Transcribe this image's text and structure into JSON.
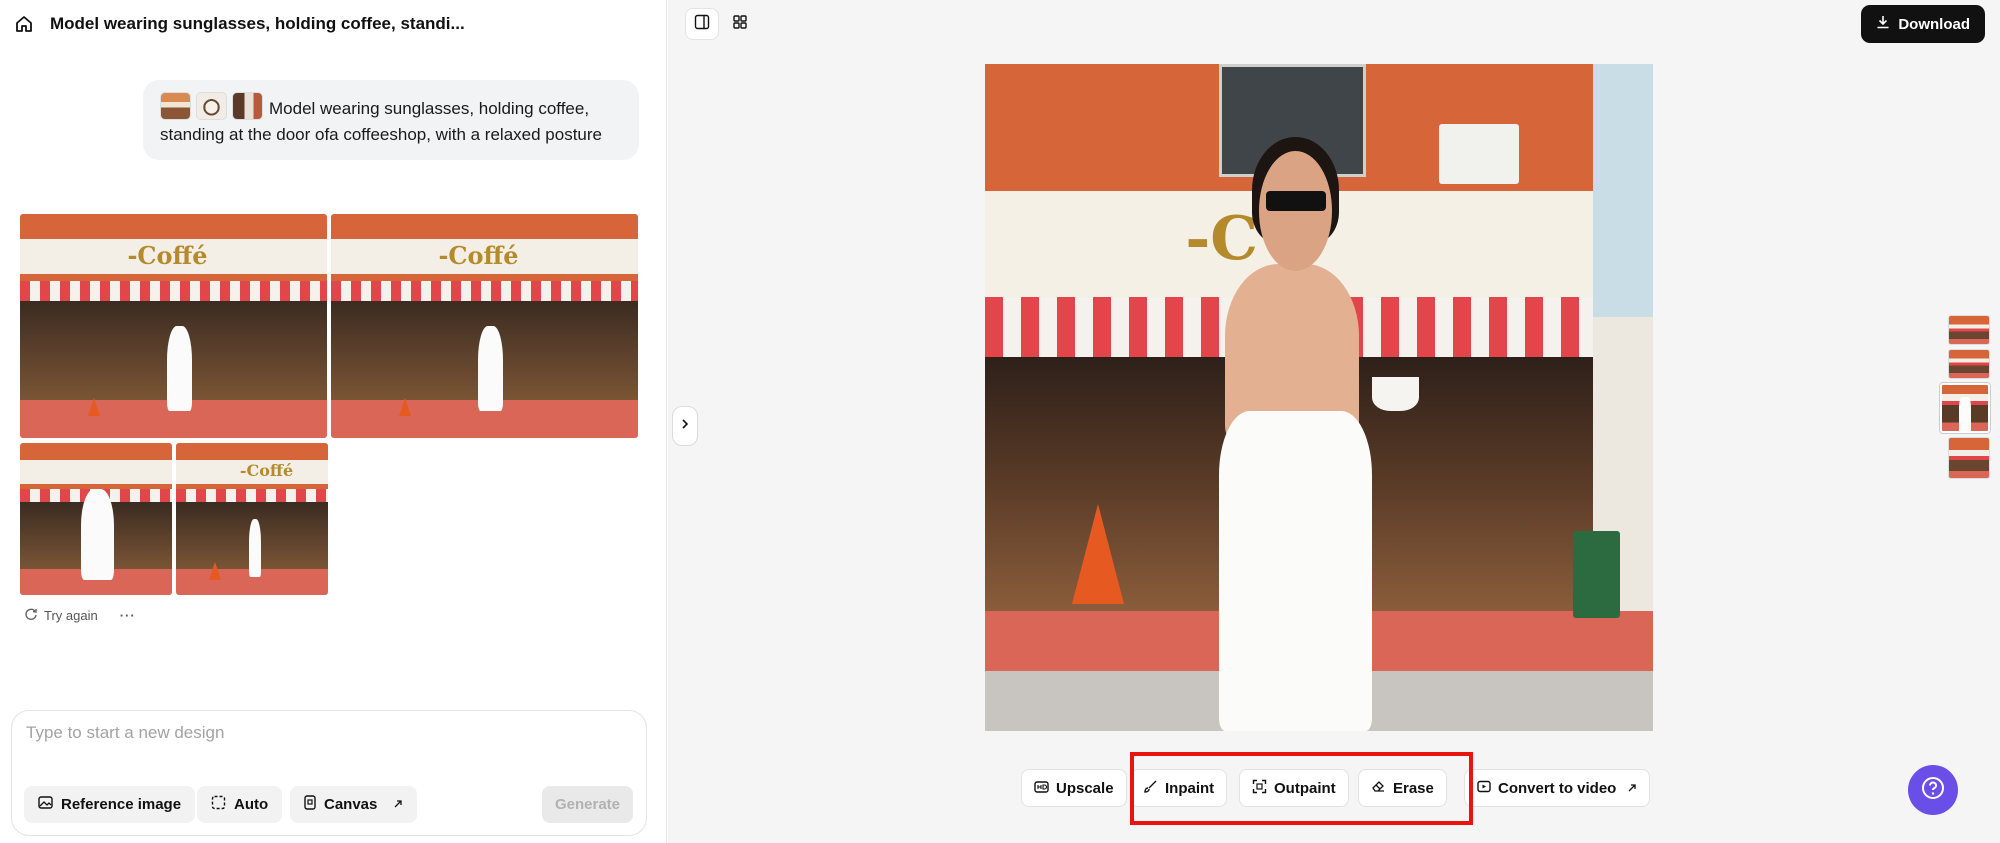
{
  "header": {
    "title": "Model wearing sunglasses, holding coffee, standi..."
  },
  "prompt": {
    "text": "Model wearing sunglasses, holding coffee, standing at the door ofa coffeeshop, with a relaxed posture"
  },
  "gallery": {
    "sign_text": "-Coffé"
  },
  "actions": {
    "try_again": "Try again",
    "more": "···"
  },
  "composer": {
    "placeholder": "Type to start a new design",
    "reference_image": "Reference image",
    "auto": "Auto",
    "canvas": "Canvas",
    "generate": "Generate"
  },
  "canvas": {
    "download": "Download",
    "main_sign_text": "-C"
  },
  "tools": {
    "upscale": "Upscale",
    "inpaint": "Inpaint",
    "outpaint": "Outpaint",
    "erase": "Erase",
    "convert_to_video": "Convert to video"
  },
  "colors": {
    "accent": "#6a4ee8",
    "highlight": "#e8150f",
    "download_bg": "#111111"
  }
}
